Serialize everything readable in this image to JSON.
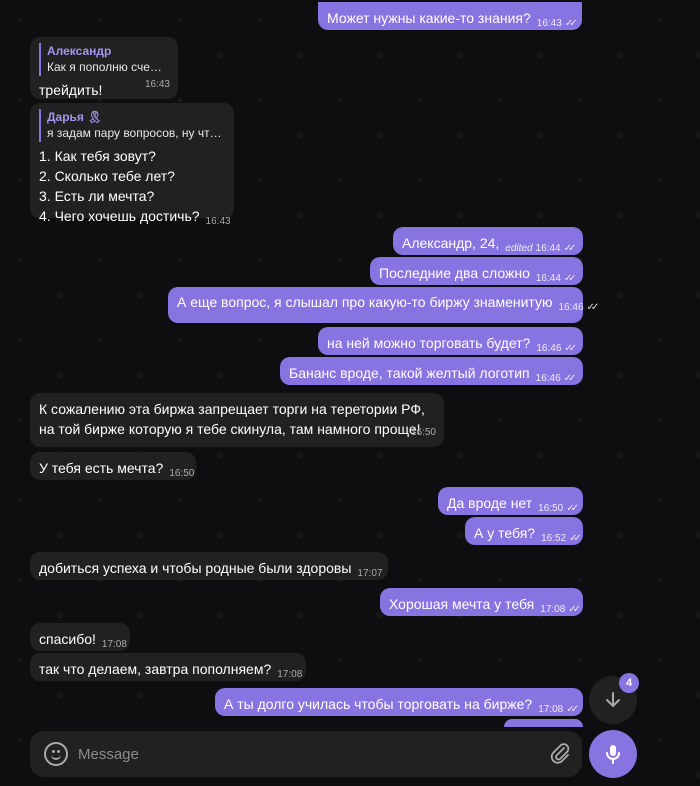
{
  "messages": [
    {
      "text": "Может нужны какие-то знания?",
      "time": "16:43",
      "dir": "out"
    },
    {
      "reply_name": "Александр",
      "reply_text": "Как я пополню сче…",
      "text": "трейдить!",
      "time": "16:43",
      "dir": "in"
    },
    {
      "reply_name": "Дарья 🎗",
      "reply_text": "я задам пару вопросов, ну чт…",
      "lines": [
        "1. Как тебя зовут?",
        "2. Сколько тебе лет?",
        "3. Есть ли мечта?",
        "4. Чего хочешь достичь?"
      ],
      "time": "16:43",
      "dir": "in"
    },
    {
      "text": "Александр, 24,",
      "edited": "edited",
      "time": "16:44",
      "dir": "out"
    },
    {
      "text": "Последние два сложно",
      "time": "16:44",
      "dir": "out"
    },
    {
      "text": "А еще вопрос, я слышал про какую-то биржу знаменитую",
      "time": "16:46",
      "dir": "out"
    },
    {
      "text": "на ней можно торговать будет?",
      "time": "16:46",
      "dir": "out"
    },
    {
      "text": "Бананс вроде, такой желтый логотип",
      "time": "16:46",
      "dir": "out"
    },
    {
      "lines": [
        "К сожалению эта биржа запрещает торги на теретории РФ,",
        "на той бирже которую я тебе скинула, там намного проще!"
      ],
      "time": "16:50",
      "dir": "in"
    },
    {
      "text": "У тебя есть мечта?",
      "time": "16:50",
      "dir": "in"
    },
    {
      "text": "Да вроде нет",
      "time": "16:50",
      "dir": "out"
    },
    {
      "text": "А у тебя?",
      "time": "16:52",
      "dir": "out"
    },
    {
      "text": "добиться успеха и чтобы родные были здоровы",
      "time": "17:07",
      "dir": "in"
    },
    {
      "text": "Хорошая мечта у тебя",
      "time": "17:08",
      "dir": "out"
    },
    {
      "text": "спасибо!",
      "time": "17:08",
      "dir": "in"
    },
    {
      "text": "так что делаем, завтра пополняем?",
      "time": "17:08",
      "dir": "in"
    },
    {
      "text": "А ты долго училась чтобы торговать на бирже?",
      "time": "17:08",
      "dir": "out"
    }
  ],
  "composer": {
    "placeholder": "Message"
  },
  "scroll_down": {
    "unread_count": "4"
  },
  "colors": {
    "accent": "#8774e1",
    "incoming": "#212121",
    "background": "#0e0e10"
  },
  "icons": {
    "emoji": "smile-icon",
    "attach": "paperclip-icon",
    "mic": "microphone-icon",
    "scroll": "arrow-down-icon"
  }
}
